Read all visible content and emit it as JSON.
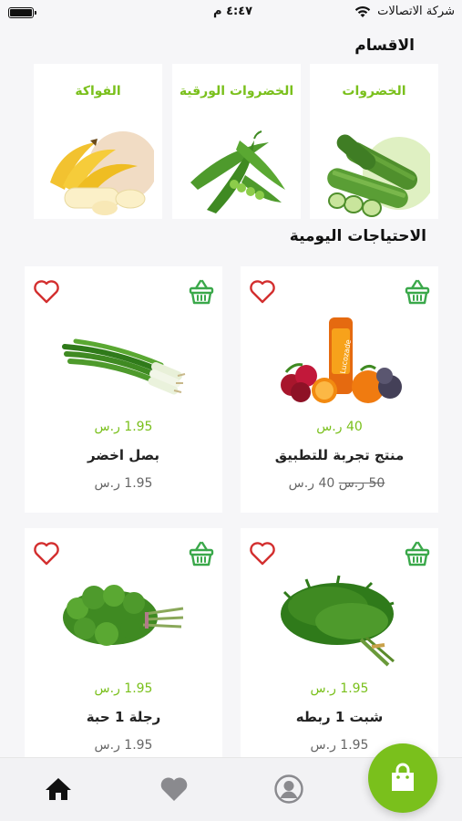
{
  "status_bar": {
    "carrier": "شركة الاتصالات",
    "time": "٤:٤٧ م"
  },
  "sections": {
    "categories_title": "الاقسام",
    "daily_title": "الاحتياجات اليومية"
  },
  "categories": [
    {
      "label": "الخضروات",
      "icon": "cucumbers-image"
    },
    {
      "label": "الخضروات الورقية",
      "icon": "peas-image"
    },
    {
      "label": "الفواكة",
      "icon": "bananas-image"
    }
  ],
  "products": [
    {
      "name": "منتج تجربة للتطبيق",
      "price": "40 ر.س",
      "old_price": "50 ر.س",
      "current_price": "40 ر.س",
      "image": "mixed-fruits-juice-image"
    },
    {
      "name": "بصل اخضر",
      "price": "1.95 ر.س",
      "old_price": "",
      "current_price": "1.95 ر.س",
      "image": "green-onion-image"
    },
    {
      "name": "شبت 1 ربطه",
      "price": "1.95 ر.س",
      "old_price": "",
      "current_price": "1.95 ر.س",
      "image": "dill-image"
    },
    {
      "name": "رجلة 1 حبة",
      "price": "1.95 ر.س",
      "old_price": "",
      "current_price": "1.95 ر.س",
      "image": "purslane-image"
    }
  ],
  "colors": {
    "accent": "#7ac01c",
    "heart": "#d32f2f",
    "basket": "#3aa84a",
    "background": "#f6f6f8"
  },
  "bottom_nav": {
    "items": [
      "home-icon",
      "heart-icon",
      "profile-icon"
    ],
    "cart_button": "shopping-bag-icon"
  }
}
